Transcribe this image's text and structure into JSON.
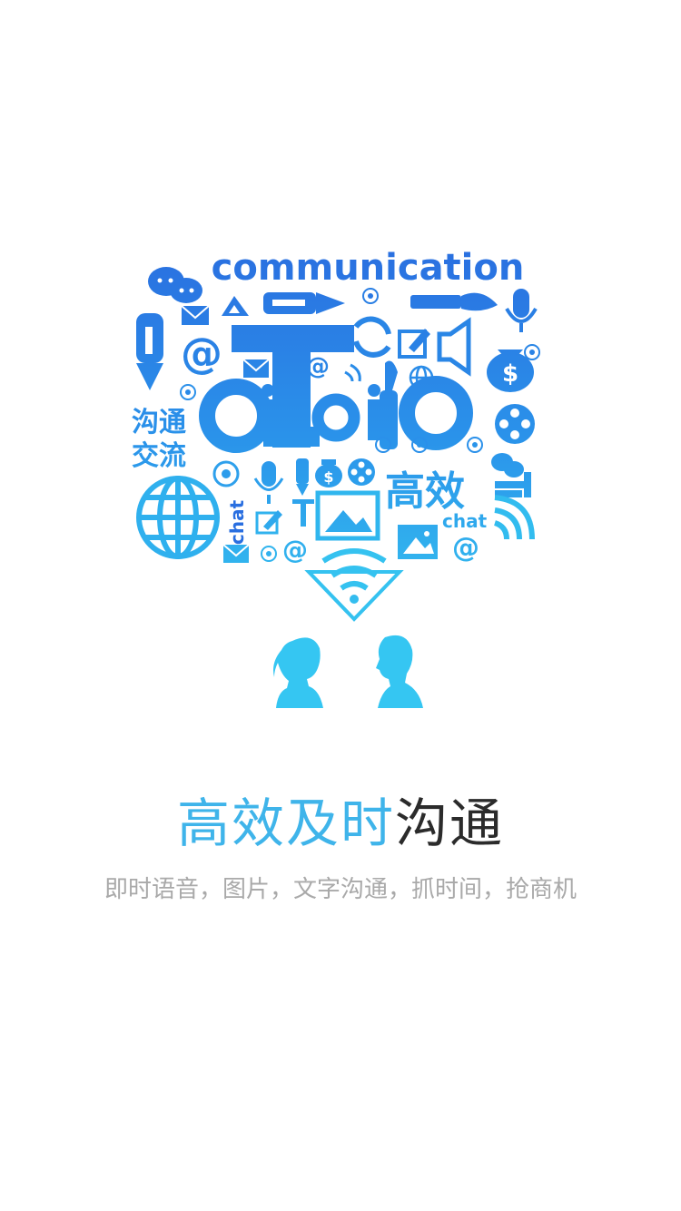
{
  "illustration": {
    "word_top": "communication",
    "word_cn_1": "沟通",
    "word_cn_2": "交流",
    "word_gaoxiao": "高效",
    "word_chat_1": "chat",
    "word_chat_2": "chat",
    "at_symbol": "@",
    "dollar_symbol": "$",
    "colors": {
      "top": "#2a6fe0",
      "mid": "#2a92ea",
      "bottom": "#35c4f0",
      "people": "#35c6f2"
    }
  },
  "headline": {
    "blue_part": "高效及时",
    "dark_part": "沟通"
  },
  "subline": "即时语音，图片，文字沟通，抓时间，抢商机"
}
